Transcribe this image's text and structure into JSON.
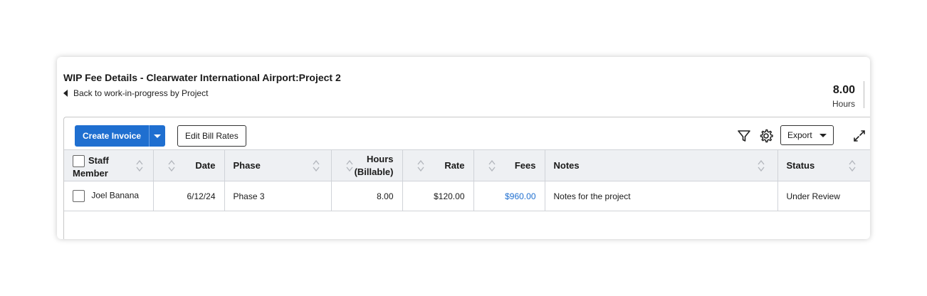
{
  "page": {
    "title": "WIP Fee Details - Clearwater International Airport:Project 2",
    "back_link": "Back to work-in-progress by Project",
    "summary": {
      "value": "8.00",
      "label": "Hours"
    }
  },
  "toolbar": {
    "create_invoice": "Create Invoice",
    "edit_bill_rates": "Edit Bill Rates",
    "export": "Export"
  },
  "table": {
    "headers": {
      "staff_line1": "Staff",
      "staff_line2": "Member",
      "date": "Date",
      "phase": "Phase",
      "hours_line1": "Hours",
      "hours_line2": "(Billable)",
      "rate": "Rate",
      "fees": "Fees",
      "notes": "Notes",
      "status": "Status"
    },
    "rows": [
      {
        "staff": "Joel Banana",
        "date": "6/12/24",
        "phase": "Phase 3",
        "hours": "8.00",
        "rate": "$120.00",
        "fees": "$960.00",
        "notes": "Notes for the project",
        "status": "Under Review"
      }
    ]
  },
  "colors": {
    "primary": "#1f6fd0",
    "header_bg": "#eef0f3"
  }
}
